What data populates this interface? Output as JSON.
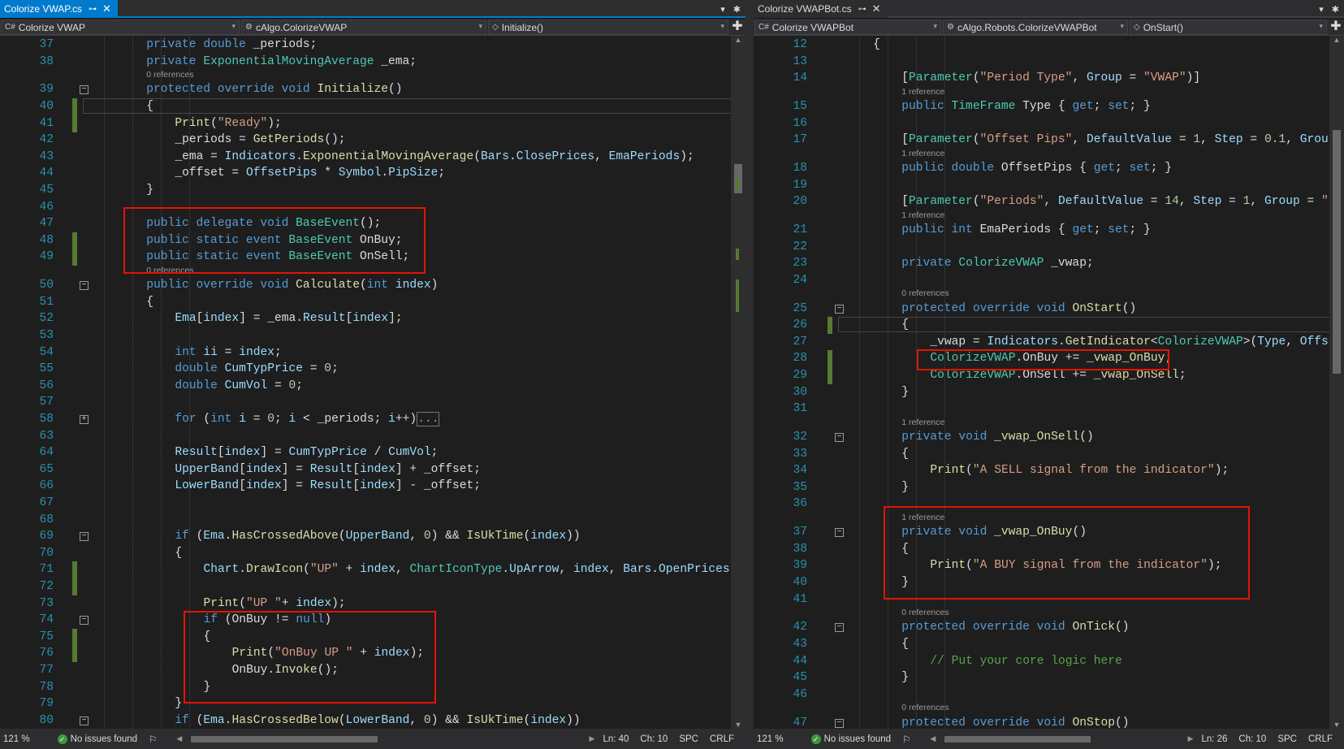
{
  "left": {
    "tab": {
      "title": "Colorize VWAP.cs",
      "pin": "⊶",
      "close": "✕"
    },
    "tab_tools": {
      "dropdown": "▾",
      "settings": "✱"
    },
    "nav": {
      "project": "Colorize VWAP",
      "class": "cAlgo.ColorizeVWAP",
      "member": "Initialize()",
      "plus": "✚"
    },
    "lines": [
      {
        "n": "37",
        "html": "<span class='k'>private</span> <span class='k'>double</span> _periods;",
        "indent": 2
      },
      {
        "n": "38",
        "html": "<span class='k'>private</span> <span class='t'>ExponentialMovingAverage</span> _ema;",
        "indent": 2
      },
      {
        "lens": "0 references"
      },
      {
        "n": "39",
        "html": "<span class='k'>protected</span> <span class='k'>override</span> <span class='k'>void</span> <span class='m'>Initialize</span>()",
        "indent": 2,
        "fold": "-"
      },
      {
        "n": "40",
        "html": "{",
        "indent": 2,
        "chg": true,
        "cur": true
      },
      {
        "n": "41",
        "html": "<span class='m'>Print</span>(<span class='s'>\"Ready\"</span>);",
        "indent": 3,
        "chg": true
      },
      {
        "n": "42",
        "html": "_periods = <span class='m'>GetPeriods</span>();",
        "indent": 3
      },
      {
        "n": "43",
        "html": "_ema = <span class='p'>Indicators</span>.<span class='m'>ExponentialMovingAverage</span>(<span class='p'>Bars</span>.<span class='p'>ClosePrices</span>, <span class='p'>EmaPeriods</span>);",
        "indent": 3
      },
      {
        "n": "44",
        "html": "_offset = <span class='p'>OffsetPips</span> * <span class='p'>Symbol</span>.<span class='p'>PipSize</span>;",
        "indent": 3
      },
      {
        "n": "45",
        "html": "}",
        "indent": 2
      },
      {
        "n": "46",
        "html": "",
        "indent": 2
      },
      {
        "n": "47",
        "html": "<span class='k'>public</span> <span class='k'>delegate</span> <span class='k'>void</span> <span class='t'>BaseEvent</span>();",
        "indent": 2
      },
      {
        "n": "48",
        "html": "<span class='k'>public</span> <span class='k'>static</span> <span class='k'>event</span> <span class='t'>BaseEvent</span> OnBuy;",
        "indent": 2,
        "chg": true
      },
      {
        "n": "49",
        "html": "<span class='k'>public</span> <span class='k'>static</span> <span class='k'>event</span> <span class='t'>BaseEvent</span> OnSell;",
        "indent": 2,
        "chg": true
      },
      {
        "lens": "0 references"
      },
      {
        "n": "50",
        "html": "<span class='k'>public</span> <span class='k'>override</span> <span class='k'>void</span> <span class='m'>Calculate</span>(<span class='k'>int</span> <span class='p'>index</span>)",
        "indent": 2,
        "fold": "-"
      },
      {
        "n": "51",
        "html": "{",
        "indent": 2
      },
      {
        "n": "52",
        "html": "<span class='p'>Ema</span>[<span class='p'>index</span>] = _ema.<span class='p'>Result</span>[<span class='p'>index</span>];",
        "indent": 3
      },
      {
        "n": "53",
        "html": "",
        "indent": 3
      },
      {
        "n": "54",
        "html": "<span class='k'>int</span> <span class='p'>ii</span> = <span class='p'>index</span>;",
        "indent": 3
      },
      {
        "n": "55",
        "html": "<span class='k'>double</span> <span class='p'>CumTypPrice</span> = <span class='n'>0</span>;",
        "indent": 3
      },
      {
        "n": "56",
        "html": "<span class='k'>double</span> <span class='p'>CumVol</span> = <span class='n'>0</span>;",
        "indent": 3
      },
      {
        "n": "57",
        "html": "",
        "indent": 3
      },
      {
        "n": "58",
        "html": "<span class='k'>for</span> (<span class='k'>int</span> <span class='p'>i</span> = <span class='n'>0</span>; <span class='p'>i</span> &lt; _periods; <span class='p'>i</span>++)<span style='border:1px solid #777;color:#999'>...</span>",
        "indent": 3,
        "fold": "+"
      },
      {
        "n": "63",
        "html": "",
        "indent": 3
      },
      {
        "n": "64",
        "html": "<span class='p'>Result</span>[<span class='p'>index</span>] = <span class='p'>CumTypPrice</span> / <span class='p'>CumVol</span>;",
        "indent": 3
      },
      {
        "n": "65",
        "html": "<span class='p'>UpperBand</span>[<span class='p'>index</span>] = <span class='p'>Result</span>[<span class='p'>index</span>] + _offset;",
        "indent": 3
      },
      {
        "n": "66",
        "html": "<span class='p'>LowerBand</span>[<span class='p'>index</span>] = <span class='p'>Result</span>[<span class='p'>index</span>] - _offset;",
        "indent": 3
      },
      {
        "n": "67",
        "html": "",
        "indent": 3
      },
      {
        "n": "68",
        "html": "",
        "indent": 3
      },
      {
        "n": "69",
        "html": "<span class='k'>if</span> (<span class='p'>Ema</span>.<span class='m'>HasCrossedAbove</span>(<span class='p'>UpperBand</span>, <span class='n'>0</span>) &amp;&amp; <span class='m'>IsUkTime</span>(<span class='p'>index</span>))",
        "indent": 3,
        "fold": "-"
      },
      {
        "n": "70",
        "html": "{",
        "indent": 3
      },
      {
        "n": "71",
        "html": "<span class='p'>Chart</span>.<span class='m'>DrawIcon</span>(<span class='s'>\"UP\"</span> + <span class='p'>index</span>, <span class='t'>ChartIconType</span>.<span class='p'>UpArrow</span>, <span class='p'>index</span>, <span class='p'>Bars</span>.<span class='p'>OpenPrices</span>[<span class='p'>i</span>",
        "indent": 4,
        "chg": true
      },
      {
        "n": "72",
        "html": "",
        "indent": 4,
        "chg": true
      },
      {
        "n": "73",
        "html": "<span class='m'>Print</span>(<span class='s'>\"UP \"</span>+ <span class='p'>index</span>);",
        "indent": 4
      },
      {
        "n": "74",
        "html": "<span class='k'>if</span> (OnBuy != <span class='k'>null</span>)",
        "indent": 4,
        "fold": "-"
      },
      {
        "n": "75",
        "html": "{",
        "indent": 4,
        "chg": true
      },
      {
        "n": "76",
        "html": "<span class='m'>Print</span>(<span class='s'>\"OnBuy UP \"</span> + <span class='p'>index</span>);",
        "indent": 5,
        "chg": true
      },
      {
        "n": "77",
        "html": "OnBuy.<span class='m'>Invoke</span>();",
        "indent": 5
      },
      {
        "n": "78",
        "html": "}",
        "indent": 4
      },
      {
        "n": "79",
        "html": "}",
        "indent": 3
      },
      {
        "n": "80",
        "html": "<span class='k'>if</span> (<span class='p'>Ema</span>.<span class='m'>HasCrossedBelow</span>(<span class='p'>LowerBand</span>, <span class='n'>0</span>) &amp;&amp; <span class='m'>IsUkTime</span>(<span class='p'>index</span>))",
        "indent": 3,
        "fold": "-"
      }
    ],
    "status": {
      "zoom": "121 %",
      "issues": "No issues found",
      "ln": "Ln: 40",
      "ch": "Ch: 10",
      "spc": "SPC",
      "eol": "CRLF"
    }
  },
  "right": {
    "tab": {
      "title": "Colorize VWAPBot.cs",
      "pin": "⊶",
      "close": "✕"
    },
    "tab_tools": {
      "dropdown": "▾",
      "settings": "✱"
    },
    "nav": {
      "project": "Colorize VWAPBot",
      "class": "cAlgo.Robots.ColorizeVWAPBot",
      "member": "OnStart()",
      "plus": "✚"
    },
    "lines": [
      {
        "n": "12",
        "html": "{",
        "indent": 1
      },
      {
        "n": "13",
        "html": "",
        "indent": 2
      },
      {
        "n": "14",
        "html": "[<span class='t'>Parameter</span>(<span class='s'>\"Period Type\"</span>, <span class='p'>Group</span> = <span class='s'>\"VWAP\"</span>)]",
        "indent": 2
      },
      {
        "lens": "1 reference"
      },
      {
        "n": "15",
        "html": "<span class='k'>public</span> <span class='t'>TimeFrame</span> Type { <span class='k'>get</span>; <span class='k'>set</span>; }",
        "indent": 2
      },
      {
        "n": "16",
        "html": "",
        "indent": 2
      },
      {
        "n": "17",
        "html": "[<span class='t'>Parameter</span>(<span class='s'>\"Offset Pips\"</span>, <span class='p'>DefaultValue</span> = <span class='n'>1</span>, <span class='p'>Step</span> = <span class='n'>0.1</span>, <span class='p'>Grou</span>",
        "indent": 2
      },
      {
        "lens": "1 reference"
      },
      {
        "n": "18",
        "html": "<span class='k'>public</span> <span class='k'>double</span> OffsetPips { <span class='k'>get</span>; <span class='k'>set</span>; }",
        "indent": 2
      },
      {
        "n": "19",
        "html": "",
        "indent": 2
      },
      {
        "n": "20",
        "html": "[<span class='t'>Parameter</span>(<span class='s'>\"Periods\"</span>, <span class='p'>DefaultValue</span> = <span class='n'>14</span>, <span class='p'>Step</span> = <span class='n'>1</span>, <span class='p'>Group</span> = <span class='s'>\"</span>",
        "indent": 2
      },
      {
        "lens": "1 reference"
      },
      {
        "n": "21",
        "html": "<span class='k'>public</span> <span class='k'>int</span> EmaPeriods { <span class='k'>get</span>; <span class='k'>set</span>; }",
        "indent": 2
      },
      {
        "n": "22",
        "html": "",
        "indent": 2
      },
      {
        "n": "23",
        "html": "<span class='k'>private</span> <span class='t'>ColorizeVWAP</span> _vwap;",
        "indent": 2
      },
      {
        "n": "24",
        "html": "",
        "indent": 2
      },
      {
        "lens": "0 references"
      },
      {
        "n": "25",
        "html": "<span class='k'>protected</span> <span class='k'>override</span> <span class='k'>void</span> <span class='m'>OnStart</span>()",
        "indent": 2,
        "fold": "-"
      },
      {
        "n": "26",
        "html": "{",
        "indent": 2,
        "chg": true,
        "cur": true
      },
      {
        "n": "27",
        "html": "_vwap = <span class='p'>Indicators</span>.<span class='m'>GetIndicator</span>&lt;<span class='t'>ColorizeVWAP</span>&gt;(<span class='p'>Type</span>, <span class='p'>Offs</span>",
        "indent": 3
      },
      {
        "n": "28",
        "html": "<span class='t'>ColorizeVWAP</span>.OnBuy += <span class='m'>_vwap_OnBuy</span>;",
        "indent": 3,
        "chg": true
      },
      {
        "n": "29",
        "html": "<span class='t'>ColorizeVWAP</span>.OnSell += <span class='m'>_vwap_OnSell</span>;",
        "indent": 3,
        "chg": true
      },
      {
        "n": "30",
        "html": "}",
        "indent": 2
      },
      {
        "n": "31",
        "html": "",
        "indent": 2
      },
      {
        "lens": "1 reference"
      },
      {
        "n": "32",
        "html": "<span class='k'>private</span> <span class='k'>void</span> <span class='m'>_vwap_OnSell</span>()",
        "indent": 2,
        "fold": "-"
      },
      {
        "n": "33",
        "html": "{",
        "indent": 2
      },
      {
        "n": "34",
        "html": "<span class='m'>Print</span>(<span class='s'>\"A SELL signal from the indicator\"</span>);",
        "indent": 3
      },
      {
        "n": "35",
        "html": "}",
        "indent": 2
      },
      {
        "n": "36",
        "html": "",
        "indent": 2
      },
      {
        "lens": "1 reference"
      },
      {
        "n": "37",
        "html": "<span class='k'>private</span> <span class='k'>void</span> <span class='m'>_vwap_OnBuy</span>()",
        "indent": 2,
        "fold": "-"
      },
      {
        "n": "38",
        "html": "{",
        "indent": 2
      },
      {
        "n": "39",
        "html": "<span class='m'>Print</span>(<span class='s'>\"A BUY signal from the indicator\"</span>);",
        "indent": 3
      },
      {
        "n": "40",
        "html": "}",
        "indent": 2
      },
      {
        "n": "41",
        "html": "",
        "indent": 2
      },
      {
        "lens": "0 references"
      },
      {
        "n": "42",
        "html": "<span class='k'>protected</span> <span class='k'>override</span> <span class='k'>void</span> <span class='m'>OnTick</span>()",
        "indent": 2,
        "fold": "-"
      },
      {
        "n": "43",
        "html": "{",
        "indent": 2
      },
      {
        "n": "44",
        "html": "<span class='c'>// Put your core logic here</span>",
        "indent": 3
      },
      {
        "n": "45",
        "html": "}",
        "indent": 2
      },
      {
        "n": "46",
        "html": "",
        "indent": 2
      },
      {
        "lens": "0 references"
      },
      {
        "n": "47",
        "html": "<span class='k'>protected</span> <span class='k'>override</span> <span class='k'>void</span> <span class='m'>OnStop</span>()",
        "indent": 2,
        "fold": "-"
      }
    ],
    "status": {
      "zoom": "121 %",
      "issues": "No issues found",
      "ln": "Ln: 26",
      "ch": "Ch: 10",
      "spc": "SPC",
      "eol": "CRLF"
    }
  },
  "icons": {
    "check": "✓",
    "brush": "⚐",
    "left_arrow": "◀",
    "right_arrow": "▶",
    "up_arrow": "▲",
    "down_arrow": "▼",
    "dropdown": "▾"
  }
}
